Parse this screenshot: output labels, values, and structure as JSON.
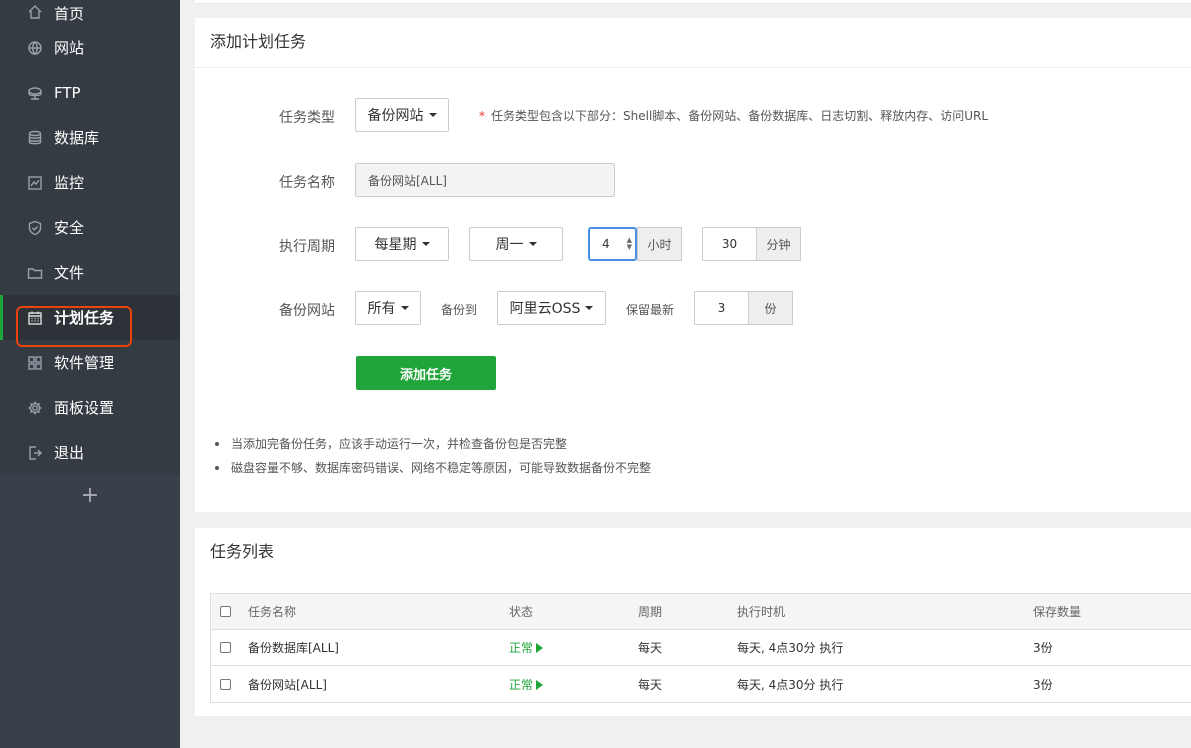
{
  "sidebar": {
    "items": [
      {
        "label": "首页",
        "icon": "home-icon"
      },
      {
        "label": "网站",
        "icon": "globe-icon"
      },
      {
        "label": "FTP",
        "icon": "ftp-icon"
      },
      {
        "label": "数据库",
        "icon": "database-icon"
      },
      {
        "label": "监控",
        "icon": "monitor-icon"
      },
      {
        "label": "安全",
        "icon": "shield-icon"
      },
      {
        "label": "文件",
        "icon": "folder-icon"
      },
      {
        "label": "计划任务",
        "icon": "calendar-icon"
      },
      {
        "label": "软件管理",
        "icon": "apps-icon"
      },
      {
        "label": "面板设置",
        "icon": "gear-icon"
      },
      {
        "label": "退出",
        "icon": "logout-icon"
      }
    ],
    "active_index": 7,
    "add_label": "+"
  },
  "add_task": {
    "title": "添加计划任务",
    "task_type_label": "任务类型",
    "task_type_value": "备份网站",
    "task_type_hint_star": "*",
    "task_type_hint": "任务类型包含以下部分：Shell脚本、备份网站、备份数据库、日志切割、释放内存、访问URL",
    "task_name_label": "任务名称",
    "task_name_value": "备份网站[ALL]",
    "cycle_label": "执行周期",
    "cycle_value": "每星期",
    "weekday_value": "周一",
    "hour_value": "4",
    "hour_unit": "小时",
    "minute_value": "30",
    "minute_unit": "分钟",
    "backup_site_label": "备份网站",
    "backup_site_value": "所有",
    "backup_to_label": "备份到",
    "backup_to_value": "阿里云OSS",
    "keep_label": "保留最新",
    "keep_value": "3",
    "keep_unit": "份",
    "submit_label": "添加任务",
    "notes": [
      "当添加完备份任务，应该手动运行一次，并检查备份包是否完整",
      "磁盘容量不够、数据库密码错误、网络不稳定等原因，可能导致数据备份不完整"
    ]
  },
  "task_list": {
    "title": "任务列表",
    "columns": [
      "任务名称",
      "状态",
      "周期",
      "执行时机",
      "保存数量"
    ],
    "rows": [
      {
        "name": "备份数据库[ALL]",
        "status": "正常",
        "cycle": "每天",
        "timing": "每天, 4点30分 执行",
        "keep": "3份"
      },
      {
        "name": "备份网站[ALL]",
        "status": "正常",
        "cycle": "每天",
        "timing": "每天, 4点30分 执行",
        "keep": "3份"
      }
    ]
  },
  "colors": {
    "accent": "#20a53a",
    "sidebar_bg": "#3a4049",
    "highlight_outline": "#e8440c"
  }
}
